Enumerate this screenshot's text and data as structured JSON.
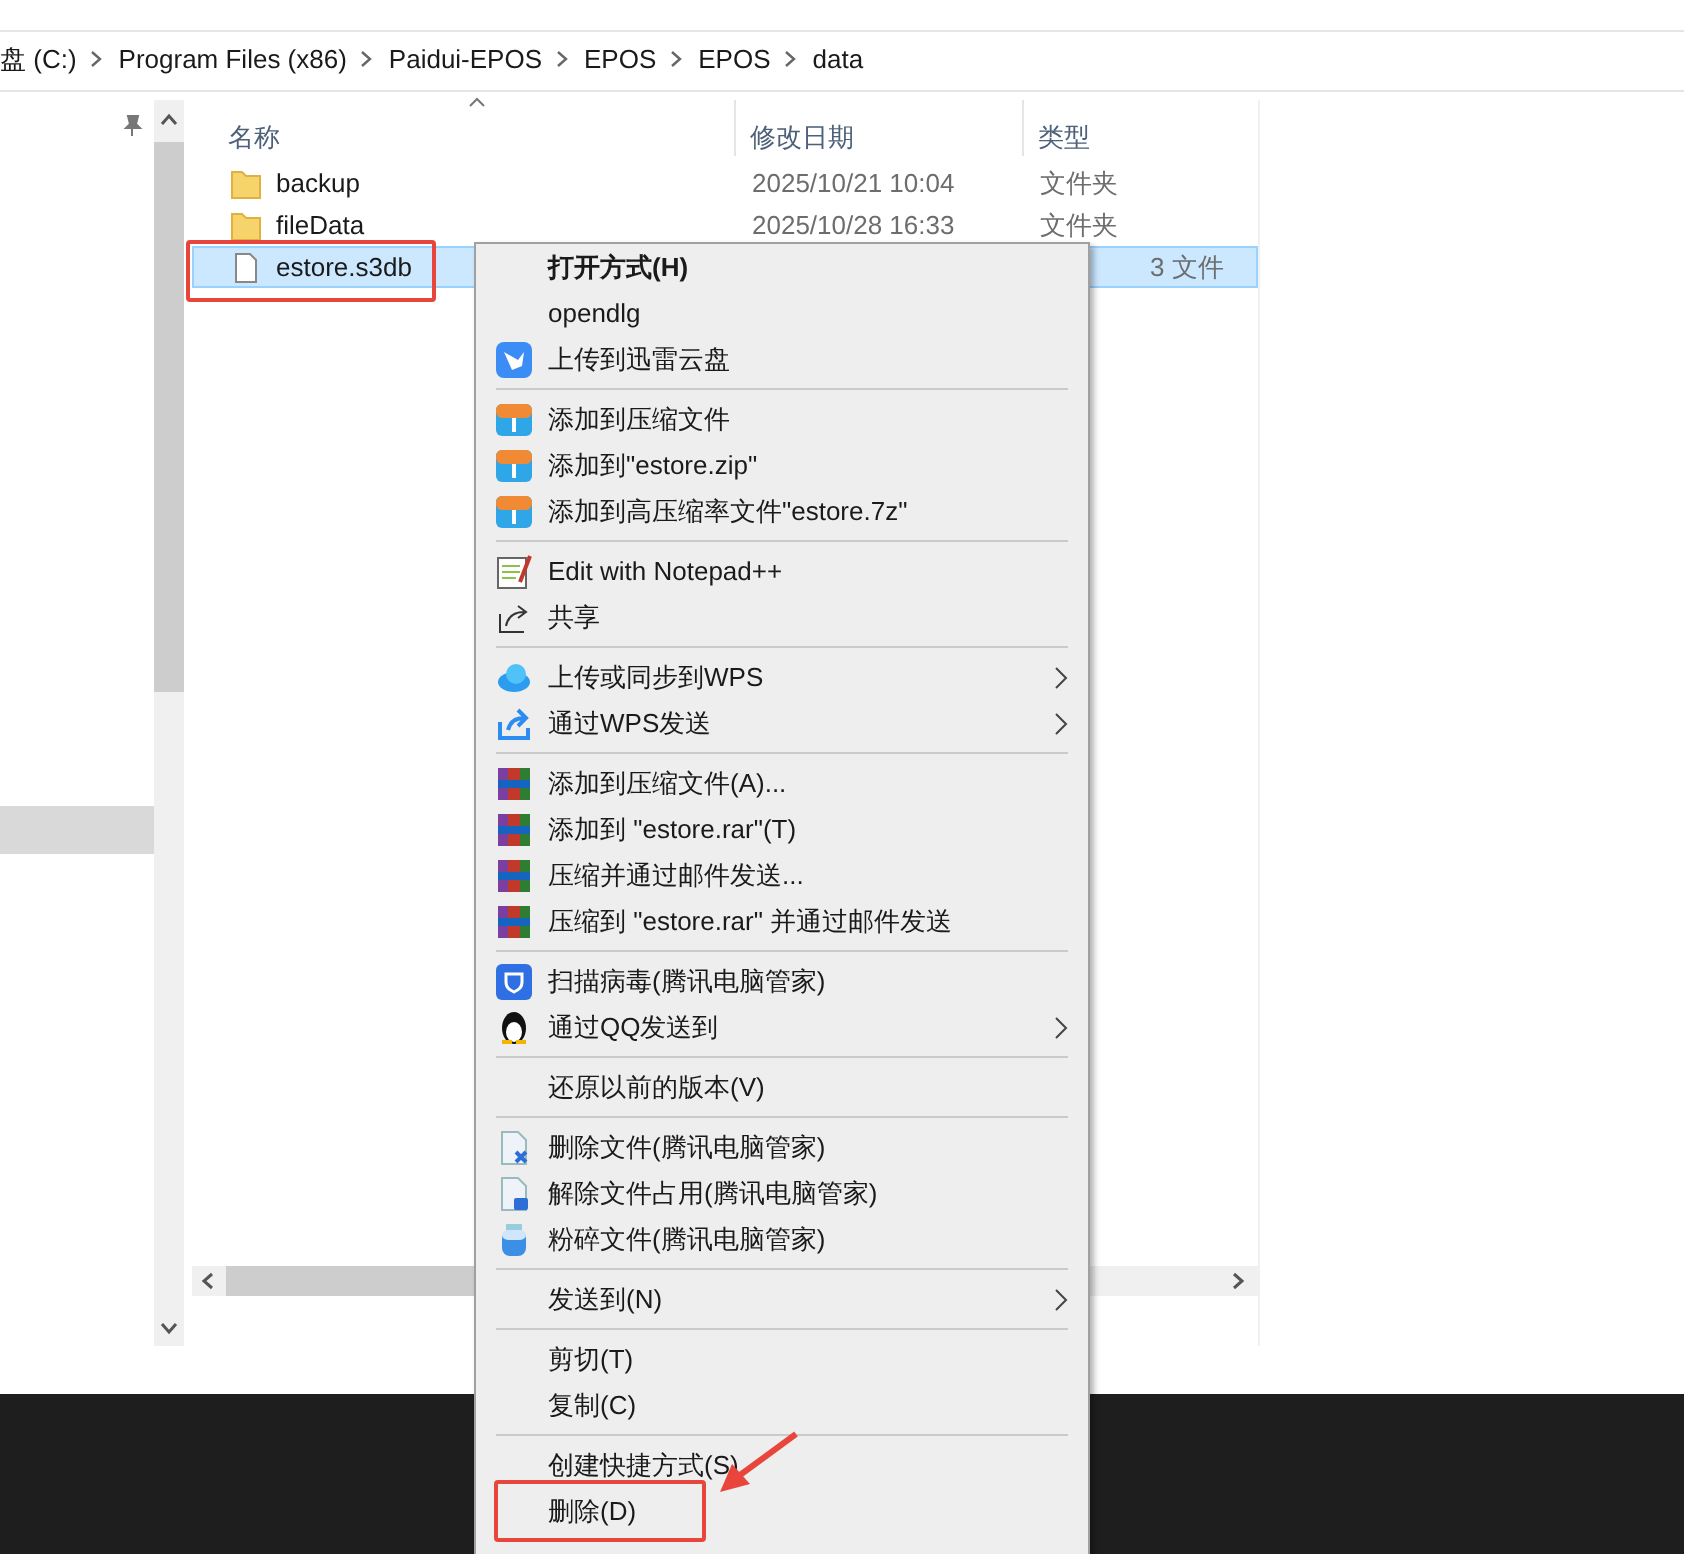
{
  "breadcrumb": [
    "盘 (C:)",
    "Program Files (x86)",
    "Paidui-EPOS",
    "EPOS",
    "EPOS",
    "data"
  ],
  "columns": [
    "名称",
    "修改日期",
    "类型"
  ],
  "files": [
    {
      "kind": "folder",
      "name": "backup",
      "date": "2025/10/21 10:04",
      "type": "文件夹",
      "selected": false,
      "highlighted": false
    },
    {
      "kind": "folder",
      "name": "fileData",
      "date": "2025/10/28 16:33",
      "type": "文件夹",
      "selected": false,
      "highlighted": false
    },
    {
      "kind": "file",
      "name": "estore.s3db",
      "type": "3 文件",
      "selected": true,
      "highlighted": true
    }
  ],
  "context_menu": {
    "groups": [
      [
        {
          "label": "打开方式(H)",
          "default": true
        },
        {
          "label": "opendlg"
        },
        {
          "label": "上传到迅雷云盘"
        }
      ],
      [
        {
          "label": "添加到压缩文件"
        },
        {
          "label": "添加到\"estore.zip\""
        },
        {
          "label": "添加到高压缩率文件\"estore.7z\""
        }
      ],
      [
        {
          "label": "Edit with Notepad++"
        },
        {
          "label": "共享"
        }
      ],
      [
        {
          "label": "上传或同步到WPS",
          "submenu": true
        },
        {
          "label": "通过WPS发送",
          "submenu": true
        }
      ],
      [
        {
          "label": "添加到压缩文件(A)..."
        },
        {
          "label": "添加到 \"estore.rar\"(T)"
        },
        {
          "label": "压缩并通过邮件发送..."
        },
        {
          "label": "压缩到 \"estore.rar\" 并通过邮件发送"
        }
      ],
      [
        {
          "label": "扫描病毒(腾讯电脑管家)"
        },
        {
          "label": "通过QQ发送到",
          "submenu": true
        }
      ],
      [
        {
          "label": "还原以前的版本(V)"
        }
      ],
      [
        {
          "label": "删除文件(腾讯电脑管家)"
        },
        {
          "label": "解除文件占用(腾讯电脑管家)"
        },
        {
          "label": "粉碎文件(腾讯电脑管家)"
        }
      ],
      [
        {
          "label": "发送到(N)",
          "submenu": true
        }
      ],
      [
        {
          "label": "剪切(T)"
        },
        {
          "label": "复制(C)"
        }
      ],
      [
        {
          "label": "创建快捷方式(S)"
        },
        {
          "label": "删除(D)",
          "highlighted": true
        }
      ]
    ]
  }
}
